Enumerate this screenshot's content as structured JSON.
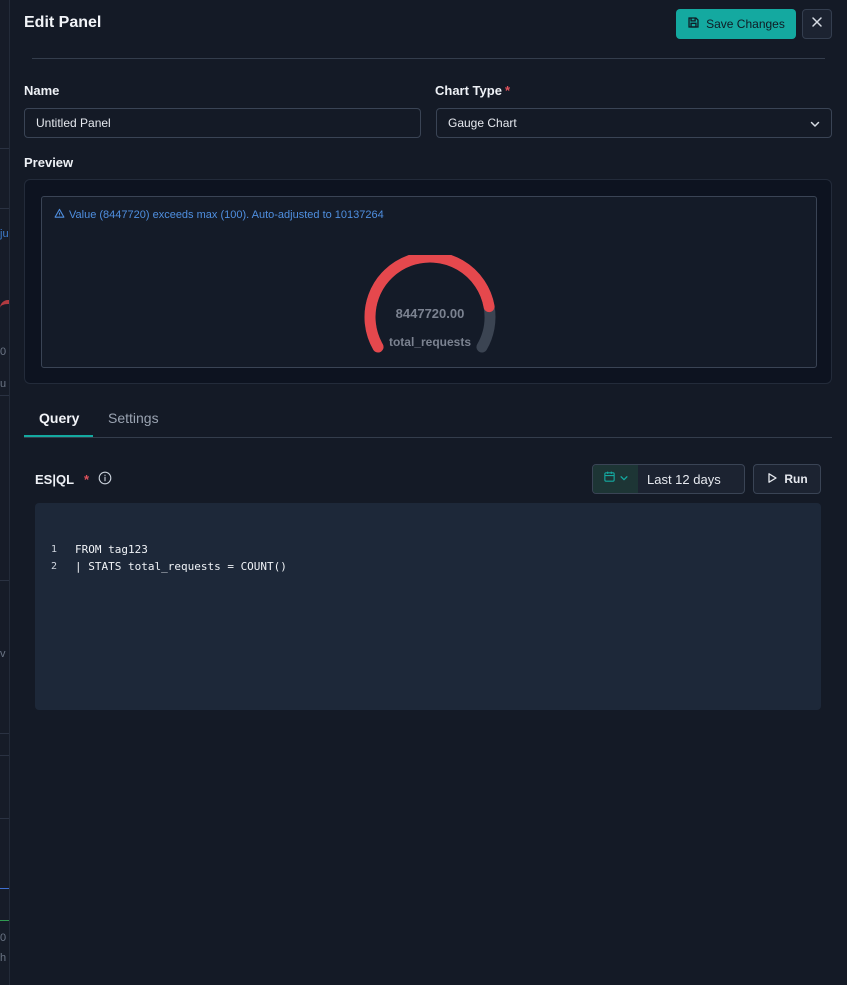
{
  "panel": {
    "title": "Edit Panel",
    "save_label": "Save Changes"
  },
  "form": {
    "name_label": "Name",
    "name_value": "Untitled Panel",
    "chart_type_label": "Chart Type",
    "required_mark": "*",
    "chart_type_value": "Gauge Chart",
    "preview_label": "Preview"
  },
  "preview": {
    "warning": "Value (8447720) exceeds max (100). Auto-adjusted to 10137264",
    "gauge_value_text": "8447720.00",
    "gauge_label": "total_requests",
    "gauge_fraction": 0.8333,
    "colors": {
      "fill": "#e5484d",
      "track": "#3b4452"
    }
  },
  "tabs": [
    {
      "label": "Query",
      "active": true
    },
    {
      "label": "Settings",
      "active": false
    }
  ],
  "query": {
    "language_label": "ES|QL",
    "required_mark": "*",
    "date_range": "Last 12 days",
    "run_label": "Run",
    "lines": [
      {
        "n": "1",
        "text": "FROM tag123"
      },
      {
        "n": "2",
        "text": "| STATS total_requests = COUNT()"
      }
    ]
  },
  "accent_color": "#14a9a0"
}
